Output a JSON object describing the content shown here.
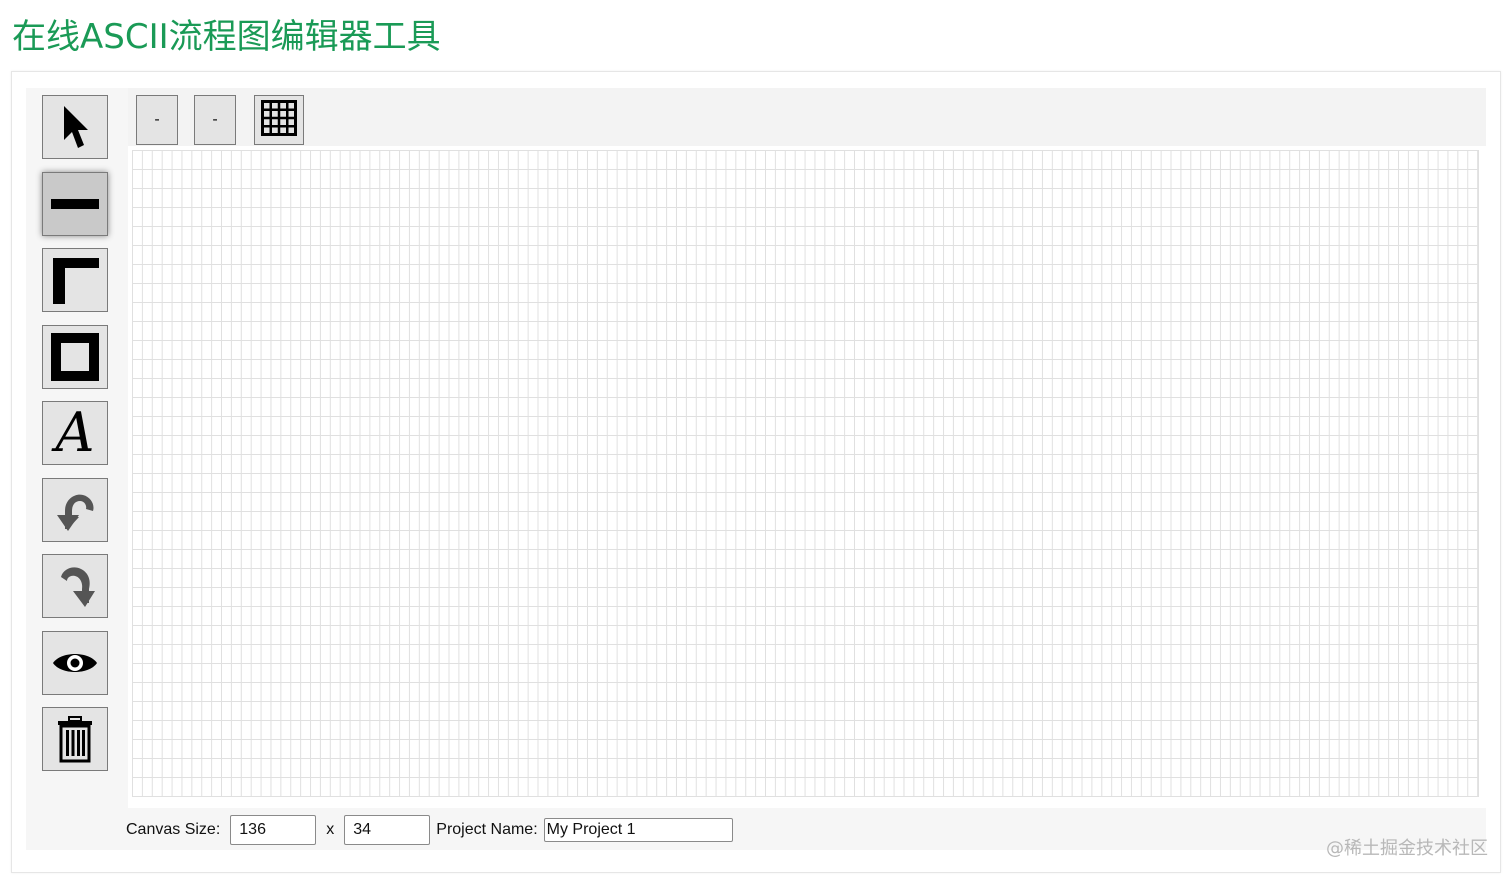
{
  "page": {
    "title": "在线ASCII流程图编辑器工具"
  },
  "toolbar": {
    "tools": [
      {
        "name": "select-tool",
        "icon": "cursor-arrow-icon"
      },
      {
        "name": "line-tool",
        "icon": "horizontal-line-icon",
        "active": true
      },
      {
        "name": "connector-tool",
        "icon": "corner-line-icon"
      },
      {
        "name": "box-tool",
        "icon": "square-box-icon"
      },
      {
        "name": "text-tool",
        "icon": "letter-a-icon",
        "label": "A"
      },
      {
        "name": "undo-tool",
        "icon": "undo-arrow-icon"
      },
      {
        "name": "redo-tool",
        "icon": "redo-arrow-icon"
      },
      {
        "name": "preview-tool",
        "icon": "eye-icon"
      },
      {
        "name": "clear-tool",
        "icon": "trash-icon"
      }
    ]
  },
  "top_bar": {
    "button1_label": "-",
    "button2_label": "-",
    "grid_toggle_icon": "grid-icon"
  },
  "canvas": {
    "grid": true
  },
  "bottom_bar": {
    "canvas_size_label": "Canvas Size:",
    "width_value": "136",
    "x_label": "x",
    "height_value": "34",
    "project_name_label": "Project Name:",
    "project_name_value": "My Project 1"
  },
  "watermark": "@稀土掘金技术社区",
  "colors": {
    "title": "#1a9a56",
    "panel_bg": "#f6f6f6",
    "button_bg": "#e4e4e4",
    "active_button_bg": "#c9c9c9",
    "grid_line": "#e0e0e0"
  }
}
